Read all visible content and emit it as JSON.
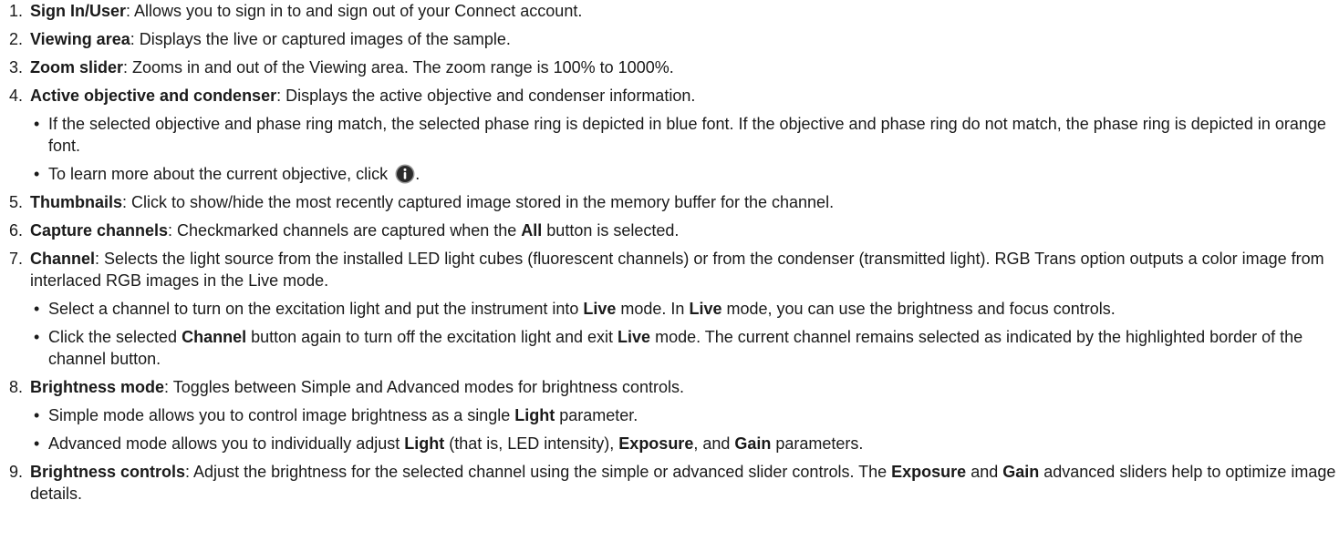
{
  "items": [
    {
      "num": "1.",
      "term": "Sign In/User",
      "desc": ": Allows you to sign in to and sign out of your Connect account."
    },
    {
      "num": "2.",
      "term": "Viewing area",
      "desc": ": Displays the live or captured images of the sample."
    },
    {
      "num": "3.",
      "term": "Zoom slider",
      "desc": ": Zooms in and out of the Viewing area. The zoom range is 100% to 1000%."
    },
    {
      "num": "4.",
      "term": "Active objective and condenser",
      "desc": ": Displays the active objective and condenser information.",
      "bullets": [
        "If the selected objective and phase ring match, the selected phase ring is depicted in blue font. If the objective and phase ring do not match, the phase ring is depicted in orange font.",
        {
          "before": "To learn more about the current objective, click ",
          "icon": "info-circle-icon",
          "after": "."
        }
      ]
    },
    {
      "num": "5.",
      "term": "Thumbnails",
      "desc": ": Click to show/hide the most recently captured image stored in the memory buffer for the channel."
    },
    {
      "num": "6.",
      "term": "Capture channels",
      "desc_a": ": Checkmarked channels are captured when the ",
      "bold": "All",
      "desc_b": " button is selected."
    },
    {
      "num": "7.",
      "term": "Channel",
      "desc": ": Selects the light source from the installed LED light cubes (fluorescent channels) or from the condenser (transmitted light). RGB Trans option outputs a color image from interlaced RGB images in the Live mode.",
      "bullets": [
        {
          "t1": "Select a channel to turn on the excitation light and put the instrument into ",
          "b1": "Live",
          "t2": " mode. In ",
          "b2": "Live",
          "t3": " mode, you can use the brightness and focus controls."
        },
        {
          "t1": "Click the selected ",
          "b1": "Channel",
          "t2": " button again to turn off the excitation light and exit ",
          "b2": "Live",
          "t3": " mode. The current channel remains selected as indicated by the highlighted border of the channel button."
        }
      ]
    },
    {
      "num": "8.",
      "term": "Brightness mode",
      "desc": ": Toggles between Simple and Advanced modes for brightness controls.",
      "bullets": [
        {
          "t1": "Simple mode allows you to control image brightness as a single ",
          "b1": "Light",
          "t2": " parameter."
        },
        {
          "t1": "Advanced mode allows you to individually adjust ",
          "b1": "Light",
          "t2": " (that is, LED intensity), ",
          "b2": "Exposure",
          "t3": ", and ",
          "b3": "Gain",
          "t4": " parameters."
        }
      ]
    },
    {
      "num": "9.",
      "term": "Brightness controls",
      "desc_a": ": Adjust the brightness for the selected channel using the simple or advanced slider controls. The ",
      "bold1": "Exposure",
      "desc_b": " and ",
      "bold2": "Gain",
      "desc_c": " advanced sliders help to optimize image details."
    }
  ],
  "colors": {
    "text": "#1a1a1a",
    "info_icon_fill": "#2b2b2b",
    "info_icon_ring": "#9a9a9a"
  }
}
